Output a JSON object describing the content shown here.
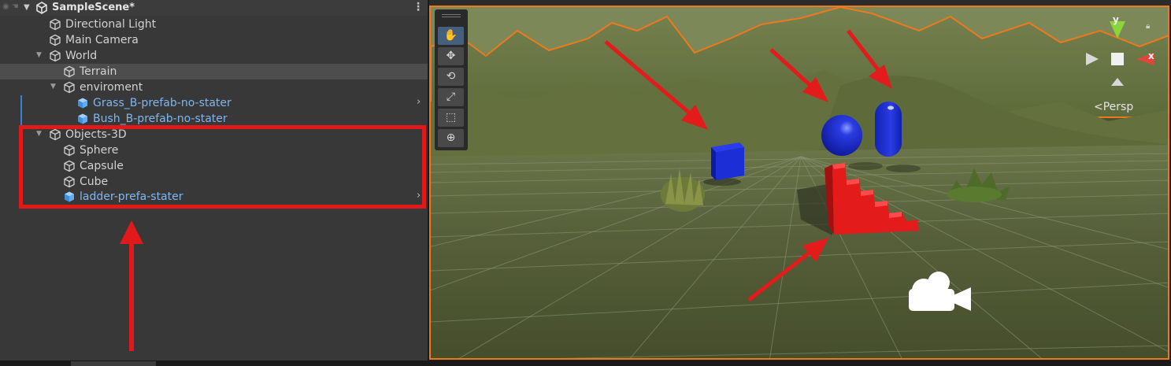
{
  "hierarchy": {
    "scene_name": "SampleScene*",
    "items": [
      {
        "label": "Directional Light",
        "kind": "object"
      },
      {
        "label": "Main Camera",
        "kind": "object"
      },
      {
        "label": "World",
        "kind": "object"
      },
      {
        "label": "Terrain",
        "kind": "object"
      },
      {
        "label": "enviroment",
        "kind": "object"
      },
      {
        "label": "Grass_B-prefab-no-stater",
        "kind": "prefab"
      },
      {
        "label": "Bush_B-prefab-no-stater",
        "kind": "prefab"
      },
      {
        "label": "Objects-3D",
        "kind": "object"
      },
      {
        "label": "Sphere",
        "kind": "object"
      },
      {
        "label": "Capsule",
        "kind": "object"
      },
      {
        "label": "Cube",
        "kind": "object"
      },
      {
        "label": "ladder-prefa-stater",
        "kind": "prefab"
      }
    ],
    "selected_item": "Terrain"
  },
  "scene_view": {
    "projection_label": "Persp",
    "gizmo": {
      "y_label": "y",
      "x_label": "x"
    },
    "tools": [
      "hand-tool",
      "move-tool",
      "rotate-tool",
      "scale-tool",
      "rect-tool",
      "transform-tool"
    ],
    "active_tool": "hand-tool"
  },
  "colors": {
    "annotation_red": "#e01a1a",
    "prefab_blue": "#7fb6ef",
    "selection_outline": "#ec7a1c",
    "object_blue": "#1c2fd6",
    "ladder_red": "#e41b1b"
  }
}
